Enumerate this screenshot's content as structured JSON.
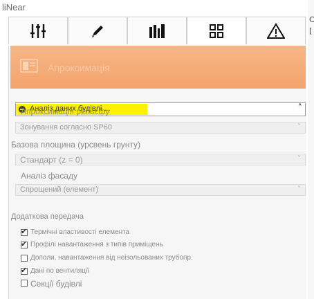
{
  "app": {
    "title": "liNear"
  },
  "toolbar": {
    "tabs": [
      {
        "icon": "sliders-icon"
      },
      {
        "icon": "pencil-icon"
      },
      {
        "icon": "library-icon"
      },
      {
        "icon": "grid-icon",
        "selected": true
      },
      {
        "icon": "warning-icon"
      }
    ]
  },
  "header": {
    "title": "Апроксимація"
  },
  "analysis": {
    "label": "Аналіз даних будівлі ..."
  },
  "fields": [
    {
      "label": "Апроксимація рельєфу",
      "value": "Зонування согласно SP60"
    },
    {
      "label": "Базова площина (урсвень грунту)",
      "value": "Стандарт (z = 0)"
    },
    {
      "label": "Аналіз фасаду",
      "value": "Спрощений (елемент)"
    }
  ],
  "transfer": {
    "title": "Додаткова передача",
    "options": [
      {
        "label": "Термічні властивості елемента",
        "checked": true
      },
      {
        "label": "Профілі навантаження з типів приміщень",
        "checked": true
      },
      {
        "label": "Дополи, навантаження від неізольованих трубопр.",
        "checked": false
      },
      {
        "label": "Дані по вентиляції",
        "checked": true
      },
      {
        "label": "Секції будівлі",
        "checked": false
      }
    ]
  },
  "colors": {
    "header_orange": "#f3a46c",
    "highlight": "#fff200"
  }
}
